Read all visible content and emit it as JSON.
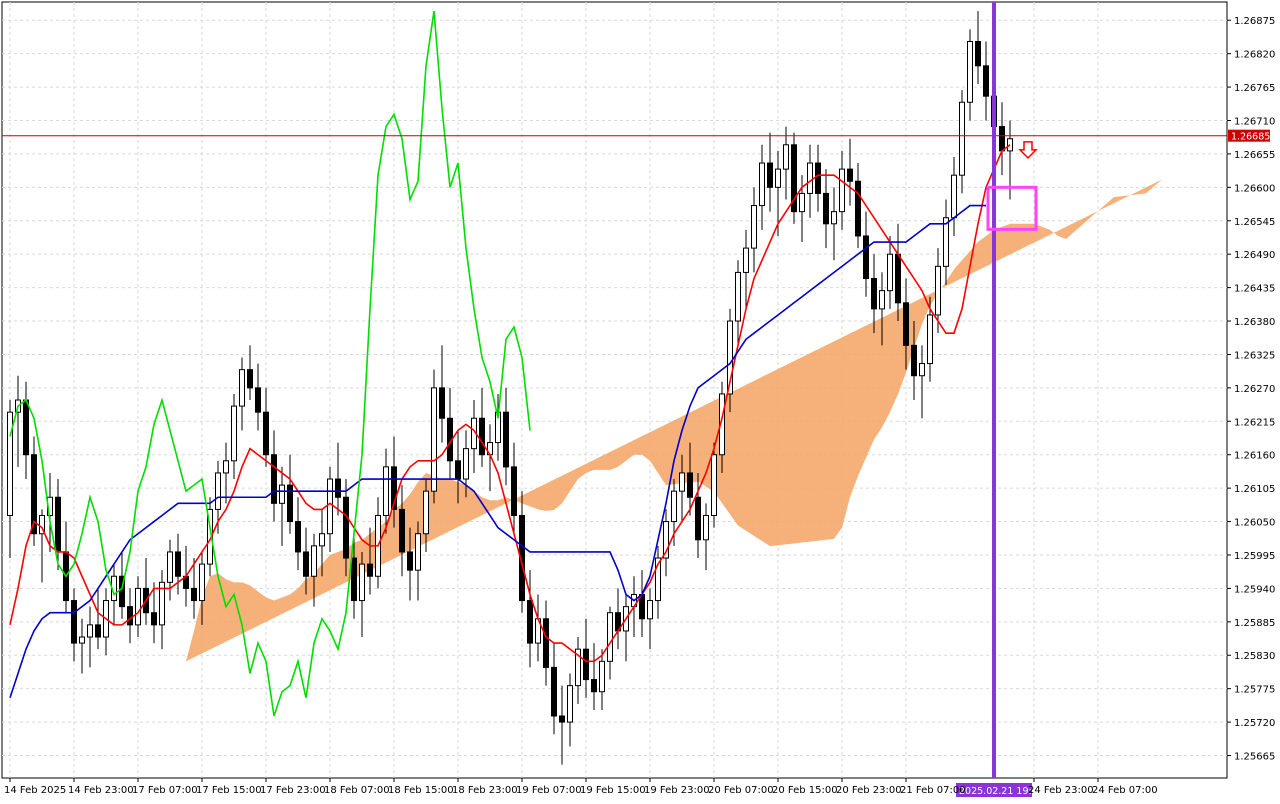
{
  "chart_data": {
    "type": "candlestick",
    "title": "",
    "price_axis": {
      "labels": [
        "1.26875",
        "1.26820",
        "1.26765",
        "1.26710",
        "1.26655",
        "1.26600",
        "1.26545",
        "1.26490",
        "1.26435",
        "1.26380",
        "1.26325",
        "1.26270",
        "1.26215",
        "1.26160",
        "1.26105",
        "1.26050",
        "1.25995",
        "1.25940",
        "1.25885",
        "1.25830",
        "1.25775",
        "1.25720",
        "1.25665"
      ],
      "ylim": [
        1.25628,
        1.26905
      ]
    },
    "time_axis": {
      "labels": [
        {
          "label": "14 Feb 2025",
          "index": 0
        },
        {
          "label": "14 Feb 23:00",
          "index": 8
        },
        {
          "label": "17 Feb 07:00",
          "index": 16
        },
        {
          "label": "17 Feb 15:00",
          "index": 24
        },
        {
          "label": "17 Feb 23:00",
          "index": 32
        },
        {
          "label": "18 Feb 07:00",
          "index": 40
        },
        {
          "label": "18 Feb 15:00",
          "index": 48
        },
        {
          "label": "18 Feb 23:00",
          "index": 56
        },
        {
          "label": "19 Feb 07:00",
          "index": 64
        },
        {
          "label": "19 Feb 15:00",
          "index": 72
        },
        {
          "label": "19 Feb 23:00",
          "index": 80
        },
        {
          "label": "20 Feb 07:00",
          "index": 88
        },
        {
          "label": "20 Feb 15:00",
          "index": 96
        },
        {
          "label": "20 Feb 23:00",
          "index": 104
        },
        {
          "label": "21 Feb 07:00",
          "index": 112
        },
        {
          "label": "24 Feb 23:00",
          "index": 128
        },
        {
          "label": "24 Feb 07:00",
          "index": 136
        }
      ],
      "highlight_label": "2025.02.21 19:00",
      "highlight_index": 123
    },
    "current_price": 1.26685,
    "candles": [
      [
        1.2606,
        1.2625,
        1.2599,
        1.2623
      ],
      [
        1.2623,
        1.2629,
        1.2614,
        1.2625
      ],
      [
        1.2625,
        1.2628,
        1.2612,
        1.2616
      ],
      [
        1.2616,
        1.2619,
        1.2601,
        1.2603
      ],
      [
        1.2603,
        1.2607,
        1.2595,
        1.2606
      ],
      [
        1.2606,
        1.2613,
        1.26,
        1.2609
      ],
      [
        1.2609,
        1.2612,
        1.2597,
        1.26
      ],
      [
        1.26,
        1.2605,
        1.259,
        1.2592
      ],
      [
        1.2592,
        1.2594,
        1.2582,
        1.2585
      ],
      [
        1.2585,
        1.2589,
        1.258,
        1.2586
      ],
      [
        1.2586,
        1.2591,
        1.2581,
        1.2588
      ],
      [
        1.2588,
        1.2594,
        1.2584,
        1.2586
      ],
      [
        1.2586,
        1.2594,
        1.2583,
        1.2592
      ],
      [
        1.2592,
        1.2598,
        1.2588,
        1.2596
      ],
      [
        1.2596,
        1.26,
        1.2589,
        1.2591
      ],
      [
        1.2591,
        1.2594,
        1.2585,
        1.2588
      ],
      [
        1.2588,
        1.2596,
        1.2586,
        1.2594
      ],
      [
        1.2594,
        1.2599,
        1.2588,
        1.259
      ],
      [
        1.259,
        1.2595,
        1.2585,
        1.2588
      ],
      [
        1.2588,
        1.2597,
        1.2584,
        1.2595
      ],
      [
        1.2595,
        1.2602,
        1.2592,
        1.26
      ],
      [
        1.26,
        1.2603,
        1.2593,
        1.2596
      ],
      [
        1.2596,
        1.2601,
        1.2591,
        1.2594
      ],
      [
        1.2594,
        1.2599,
        1.2589,
        1.2592
      ],
      [
        1.2592,
        1.26,
        1.2588,
        1.2598
      ],
      [
        1.2598,
        1.2609,
        1.2596,
        1.2607
      ],
      [
        1.2607,
        1.2615,
        1.2603,
        1.2613
      ],
      [
        1.2613,
        1.2618,
        1.2608,
        1.2615
      ],
      [
        1.2615,
        1.2626,
        1.2612,
        1.2624
      ],
      [
        1.2624,
        1.2632,
        1.262,
        1.263
      ],
      [
        1.263,
        1.2634,
        1.2625,
        1.2627
      ],
      [
        1.2627,
        1.2631,
        1.262,
        1.2623
      ],
      [
        1.2623,
        1.2627,
        1.2614,
        1.2616
      ],
      [
        1.2616,
        1.262,
        1.2605,
        1.2608
      ],
      [
        1.2608,
        1.2614,
        1.2601,
        1.2611
      ],
      [
        1.2611,
        1.2616,
        1.2603,
        1.2605
      ],
      [
        1.2605,
        1.2609,
        1.2597,
        1.26
      ],
      [
        1.26,
        1.2604,
        1.2593,
        1.2596
      ],
      [
        1.2596,
        1.2603,
        1.2591,
        1.2601
      ],
      [
        1.2601,
        1.2607,
        1.2596,
        1.2603
      ],
      [
        1.2603,
        1.2614,
        1.26,
        1.2612
      ],
      [
        1.2612,
        1.2618,
        1.2606,
        1.2609
      ],
      [
        1.2609,
        1.2612,
        1.2596,
        1.2599
      ],
      [
        1.2599,
        1.2603,
        1.2589,
        1.2592
      ],
      [
        1.2592,
        1.26,
        1.2586,
        1.2598
      ],
      [
        1.2598,
        1.2604,
        1.2593,
        1.2596
      ],
      [
        1.2596,
        1.2609,
        1.2594,
        1.2606
      ],
      [
        1.2606,
        1.2617,
        1.2603,
        1.2614
      ],
      [
        1.2614,
        1.2619,
        1.2604,
        1.2607
      ],
      [
        1.2607,
        1.2611,
        1.2596,
        1.26
      ],
      [
        1.26,
        1.2604,
        1.2592,
        1.2597
      ],
      [
        1.2597,
        1.2605,
        1.2592,
        1.2603
      ],
      [
        1.2603,
        1.2612,
        1.26,
        1.261
      ],
      [
        1.261,
        1.263,
        1.2608,
        1.2627
      ],
      [
        1.2627,
        1.2634,
        1.2618,
        1.2622
      ],
      [
        1.2622,
        1.2627,
        1.2612,
        1.2615
      ],
      [
        1.2615,
        1.262,
        1.2608,
        1.2612
      ],
      [
        1.2612,
        1.262,
        1.2609,
        1.2617
      ],
      [
        1.2617,
        1.2625,
        1.2613,
        1.2622
      ],
      [
        1.2622,
        1.2627,
        1.2614,
        1.2616
      ],
      [
        1.2616,
        1.2621,
        1.261,
        1.2618
      ],
      [
        1.2618,
        1.2626,
        1.2615,
        1.2623
      ],
      [
        1.2623,
        1.2627,
        1.2611,
        1.2614
      ],
      [
        1.2614,
        1.2618,
        1.2603,
        1.2606
      ],
      [
        1.2606,
        1.261,
        1.259,
        1.2592
      ],
      [
        1.2592,
        1.2597,
        1.2581,
        1.2585
      ],
      [
        1.2585,
        1.2593,
        1.2582,
        1.2589
      ],
      [
        1.2589,
        1.2592,
        1.2578,
        1.2581
      ],
      [
        1.2581,
        1.2585,
        1.257,
        1.2573
      ],
      [
        1.2573,
        1.2578,
        1.2565,
        1.2572
      ],
      [
        1.2572,
        1.258,
        1.2568,
        1.2578
      ],
      [
        1.2578,
        1.2586,
        1.2575,
        1.2584
      ],
      [
        1.2584,
        1.2589,
        1.2576,
        1.2579
      ],
      [
        1.2579,
        1.2585,
        1.2574,
        1.2577
      ],
      [
        1.2577,
        1.2584,
        1.2574,
        1.2582
      ],
      [
        1.2582,
        1.2591,
        1.2579,
        1.259
      ],
      [
        1.259,
        1.2594,
        1.2584,
        1.2587
      ],
      [
        1.2587,
        1.2593,
        1.2582,
        1.2591
      ],
      [
        1.2591,
        1.2596,
        1.2586,
        1.2593
      ],
      [
        1.2593,
        1.2597,
        1.2586,
        1.2589
      ],
      [
        1.2589,
        1.2594,
        1.2584,
        1.2592
      ],
      [
        1.2592,
        1.2601,
        1.2589,
        1.2599
      ],
      [
        1.2599,
        1.2607,
        1.2596,
        1.2605
      ],
      [
        1.2605,
        1.2612,
        1.2601,
        1.261
      ],
      [
        1.261,
        1.2616,
        1.2605,
        1.2613
      ],
      [
        1.2613,
        1.2618,
        1.2606,
        1.2609
      ],
      [
        1.2609,
        1.2613,
        1.2599,
        1.2602
      ],
      [
        1.2602,
        1.2608,
        1.2597,
        1.2606
      ],
      [
        1.2606,
        1.2618,
        1.2604,
        1.2616
      ],
      [
        1.2616,
        1.2628,
        1.2613,
        1.2626
      ],
      [
        1.2626,
        1.264,
        1.2623,
        1.2638
      ],
      [
        1.2638,
        1.2648,
        1.2634,
        1.2646
      ],
      [
        1.2646,
        1.2653,
        1.264,
        1.265
      ],
      [
        1.265,
        1.266,
        1.2646,
        1.2657
      ],
      [
        1.2657,
        1.2667,
        1.2653,
        1.2664
      ],
      [
        1.2664,
        1.2669,
        1.2656,
        1.266
      ],
      [
        1.266,
        1.2666,
        1.2652,
        1.2663
      ],
      [
        1.2663,
        1.267,
        1.2658,
        1.2667
      ],
      [
        1.2667,
        1.2669,
        1.2654,
        1.2656
      ],
      [
        1.2656,
        1.2662,
        1.2651,
        1.2659
      ],
      [
        1.2659,
        1.2667,
        1.2655,
        1.2664
      ],
      [
        1.2664,
        1.2667,
        1.2656,
        1.2659
      ],
      [
        1.2659,
        1.2663,
        1.265,
        1.2654
      ],
      [
        1.2654,
        1.266,
        1.2648,
        1.2656
      ],
      [
        1.2656,
        1.2666,
        1.2653,
        1.2663
      ],
      [
        1.2663,
        1.2668,
        1.2657,
        1.2661
      ],
      [
        1.2661,
        1.2664,
        1.265,
        1.2652
      ],
      [
        1.2652,
        1.2656,
        1.2642,
        1.2645
      ],
      [
        1.2645,
        1.2649,
        1.2636,
        1.264
      ],
      [
        1.264,
        1.2646,
        1.2634,
        1.2643
      ],
      [
        1.2643,
        1.2652,
        1.264,
        1.2649
      ],
      [
        1.2649,
        1.2654,
        1.2638,
        1.2641
      ],
      [
        1.2641,
        1.2645,
        1.263,
        1.2634
      ],
      [
        1.2634,
        1.2638,
        1.2625,
        1.2629
      ],
      [
        1.2629,
        1.2634,
        1.2622,
        1.2631
      ],
      [
        1.2631,
        1.2642,
        1.2628,
        1.2639
      ],
      [
        1.2639,
        1.265,
        1.2636,
        1.2647
      ],
      [
        1.2647,
        1.2658,
        1.2644,
        1.2655
      ],
      [
        1.2655,
        1.2665,
        1.2652,
        1.2662
      ],
      [
        1.2662,
        1.2676,
        1.2659,
        1.2674
      ],
      [
        1.2674,
        1.2686,
        1.2671,
        1.2684
      ],
      [
        1.2684,
        1.2689,
        1.2677,
        1.268
      ],
      [
        1.268,
        1.2684,
        1.2671,
        1.2675
      ],
      [
        1.2675,
        1.2679,
        1.2666,
        1.267
      ],
      [
        1.267,
        1.2674,
        1.2662,
        1.2666
      ],
      [
        1.2666,
        1.2671,
        1.2658,
        1.2668
      ]
    ],
    "series": [
      {
        "name": "",
        "color": "#ff0000",
        "values": [
          1.2588,
          1.2594,
          1.2601,
          1.2605,
          1.2604,
          1.2601,
          1.26,
          1.26,
          1.2599,
          1.2596,
          1.2593,
          1.259,
          1.2589,
          1.2588,
          1.2588,
          1.2589,
          1.259,
          1.2592,
          1.2594,
          1.2594,
          1.2594,
          1.2595,
          1.2596,
          1.2598,
          1.26,
          1.2602,
          1.2605,
          1.2607,
          1.261,
          1.2614,
          1.2617,
          1.2616,
          1.2615,
          1.2614,
          1.2613,
          1.2612,
          1.261,
          1.2608,
          1.2607,
          1.2607,
          1.2608,
          1.2607,
          1.2606,
          1.2604,
          1.2602,
          1.2601,
          1.2601,
          1.2604,
          1.2608,
          1.2612,
          1.2614,
          1.2615,
          1.2615,
          1.2615,
          1.2616,
          1.2618,
          1.262,
          1.2621,
          1.262,
          1.2618,
          1.2616,
          1.2613,
          1.2608,
          1.2603,
          1.2598,
          1.2593,
          1.2589,
          1.2586,
          1.2585,
          1.2585,
          1.2584,
          1.2583,
          1.2582,
          1.2582,
          1.2583,
          1.2585,
          1.2587,
          1.2589,
          1.2591,
          1.2593,
          1.2595,
          1.2598,
          1.26,
          1.2603,
          1.2605,
          1.2607,
          1.261,
          1.2613,
          1.2617,
          1.2622,
          1.2628,
          1.2634,
          1.264,
          1.2645,
          1.2648,
          1.2651,
          1.2654,
          1.2656,
          1.2658,
          1.266,
          1.2661,
          1.2662,
          1.2662,
          1.2662,
          1.2661,
          1.266,
          1.2659,
          1.2657,
          1.2655,
          1.2653,
          1.2651,
          1.2649,
          1.2647,
          1.2645,
          1.2643,
          1.264,
          1.2638,
          1.2636,
          1.2636,
          1.264,
          1.2647,
          1.2654,
          1.266,
          1.2663,
          1.2666,
          1.2667
        ]
      },
      {
        "name": "",
        "color": "#0000cc",
        "values": [
          1.2576,
          1.258,
          1.2584,
          1.2587,
          1.2589,
          1.259,
          1.259,
          1.259,
          1.259,
          1.2591,
          1.2592,
          1.2594,
          1.2596,
          1.2598,
          1.26,
          1.2602,
          1.2603,
          1.2604,
          1.2605,
          1.2606,
          1.2607,
          1.2608,
          1.2608,
          1.2608,
          1.2608,
          1.2608,
          1.2609,
          1.2609,
          1.2609,
          1.2609,
          1.2609,
          1.2609,
          1.2609,
          1.261,
          1.261,
          1.261,
          1.261,
          1.261,
          1.261,
          1.261,
          1.261,
          1.261,
          1.261,
          1.2611,
          1.2612,
          1.2612,
          1.2612,
          1.2612,
          1.2612,
          1.2612,
          1.2612,
          1.2612,
          1.2612,
          1.2612,
          1.2612,
          1.2612,
          1.2612,
          1.2611,
          1.261,
          1.2608,
          1.2606,
          1.2604,
          1.2603,
          1.2602,
          1.2601,
          1.26,
          1.26,
          1.26,
          1.26,
          1.26,
          1.26,
          1.26,
          1.26,
          1.26,
          1.26,
          1.26,
          1.2597,
          1.2593,
          1.2592,
          1.2593,
          1.2596,
          1.2602,
          1.2608,
          1.2615,
          1.262,
          1.2624,
          1.2627,
          1.2628,
          1.2629,
          1.263,
          1.2631,
          1.2633,
          1.2635,
          1.2636,
          1.2637,
          1.2638,
          1.2639,
          1.264,
          1.2641,
          1.2642,
          1.2643,
          1.2644,
          1.2645,
          1.2646,
          1.2647,
          1.2648,
          1.2649,
          1.265,
          1.2651,
          1.2651,
          1.2651,
          1.2651,
          1.2651,
          1.2652,
          1.2653,
          1.2654,
          1.2654,
          1.2654,
          1.2655,
          1.2656,
          1.2657,
          1.2657,
          1.2657
        ]
      },
      {
        "name": "",
        "color": "#00dd00",
        "values": [
          1.2619,
          1.2624,
          1.2625,
          1.2622,
          1.2615,
          1.2605,
          1.2598,
          1.2596,
          1.2598,
          1.2603,
          1.2609,
          1.2605,
          1.2597,
          1.2593,
          1.2594,
          1.26,
          1.261,
          1.2614,
          1.2621,
          1.2625,
          1.262,
          1.2615,
          1.261,
          1.2611,
          1.2612,
          1.2604,
          1.2596,
          1.2591,
          1.2593,
          1.2588,
          1.258,
          1.2585,
          1.2582,
          1.2573,
          1.2577,
          1.2578,
          1.2582,
          1.2576,
          1.2585,
          1.2589,
          1.2587,
          1.2584,
          1.259,
          1.2603,
          1.2616,
          1.264,
          1.2662,
          1.267,
          1.2672,
          1.2668,
          1.2658,
          1.2661,
          1.268,
          1.2689,
          1.2673,
          1.266,
          1.2664,
          1.265,
          1.264,
          1.2632,
          1.2628,
          1.2622,
          1.2635,
          1.2637,
          1.2632,
          1.262
        ]
      }
    ],
    "cloud": {
      "color": "#f4a261",
      "secondary_color": "#d1b3d8"
    },
    "annotations": [
      {
        "label": "sell arrow",
        "color": "#ff0000"
      },
      {
        "label": "highlight box",
        "color": "#ff44ff"
      }
    ]
  }
}
